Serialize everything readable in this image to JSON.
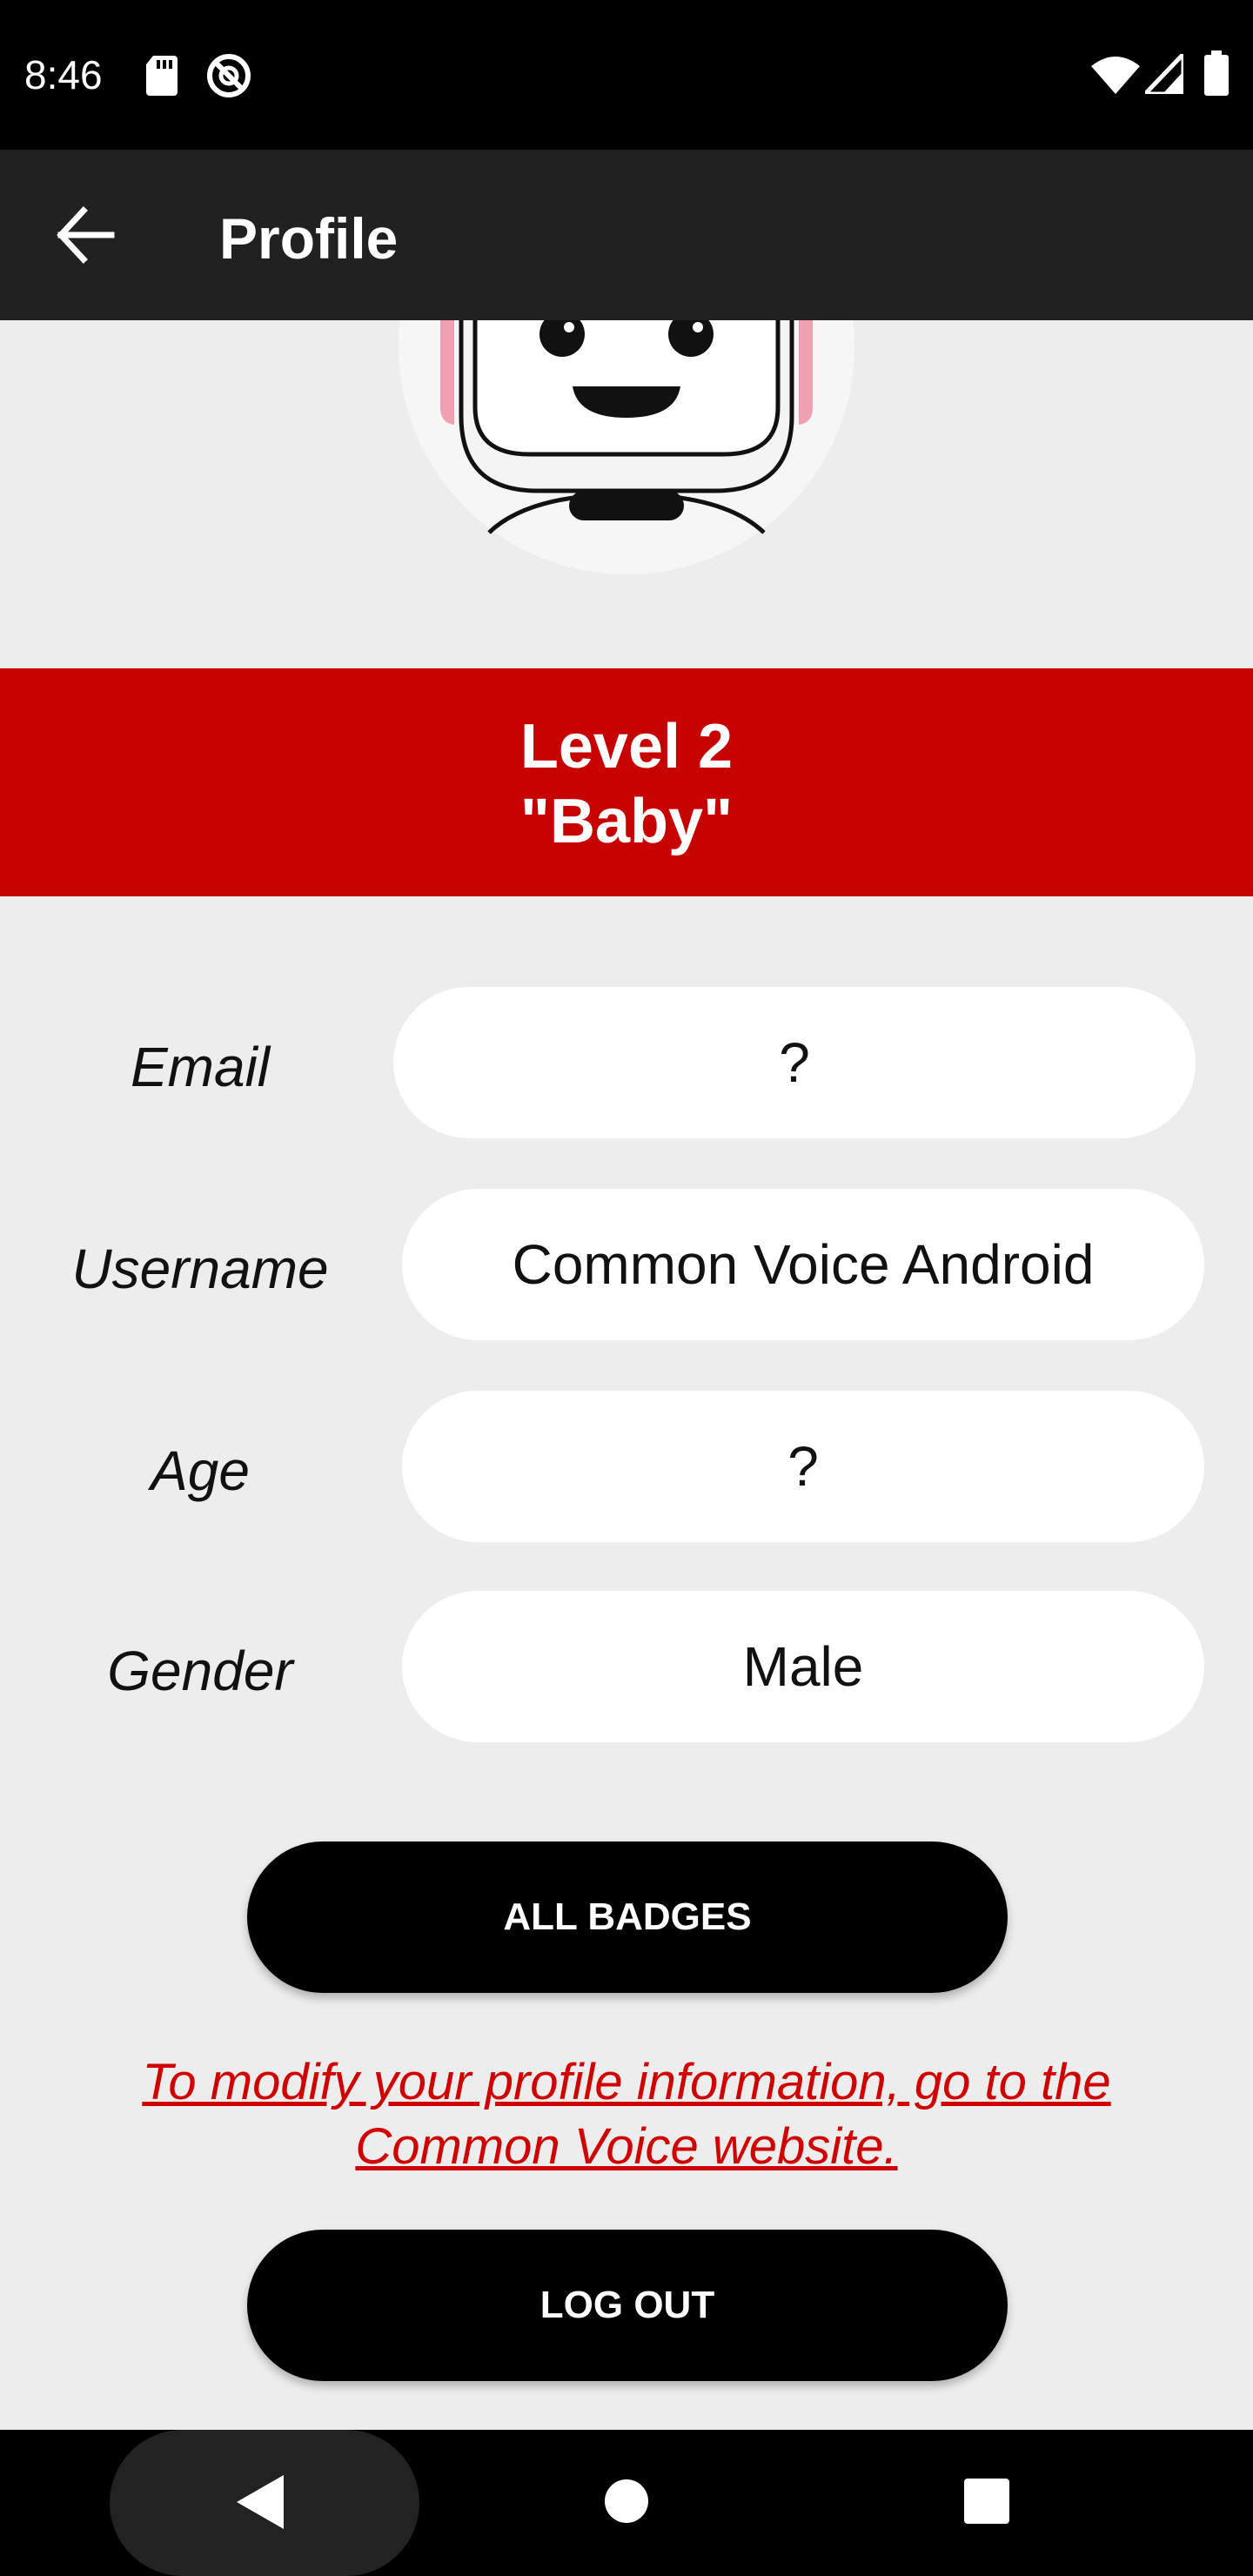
{
  "status_bar": {
    "time": "8:46",
    "icons": [
      "sd-card-icon",
      "sync-disabled-icon",
      "wifi-icon",
      "cell-signal-icon",
      "battery-icon"
    ]
  },
  "app_bar": {
    "title": "Profile",
    "back_icon": "arrow-back-icon"
  },
  "avatar": {
    "icon": "robot-avatar-icon"
  },
  "level": {
    "line1": "Level 2",
    "line2": "\"Baby\"",
    "color": "#c70000"
  },
  "fields": [
    {
      "label": "Email",
      "value": "?"
    },
    {
      "label": "Username",
      "value": "Common Voice Android"
    },
    {
      "label": "Age",
      "value": "?"
    },
    {
      "label": "Gender",
      "value": "Male"
    }
  ],
  "buttons": {
    "badges": "ALL BADGES",
    "logout": "LOG OUT"
  },
  "note": "To modify your profile information, go to the Common Voice website.",
  "nav_bar": {
    "icons": [
      "nav-back-icon",
      "nav-home-icon",
      "nav-recents-icon"
    ]
  },
  "colors": {
    "accent_red": "#c70000",
    "app_bar": "#212121",
    "background": "#ededed",
    "link_red": "#d00000"
  }
}
